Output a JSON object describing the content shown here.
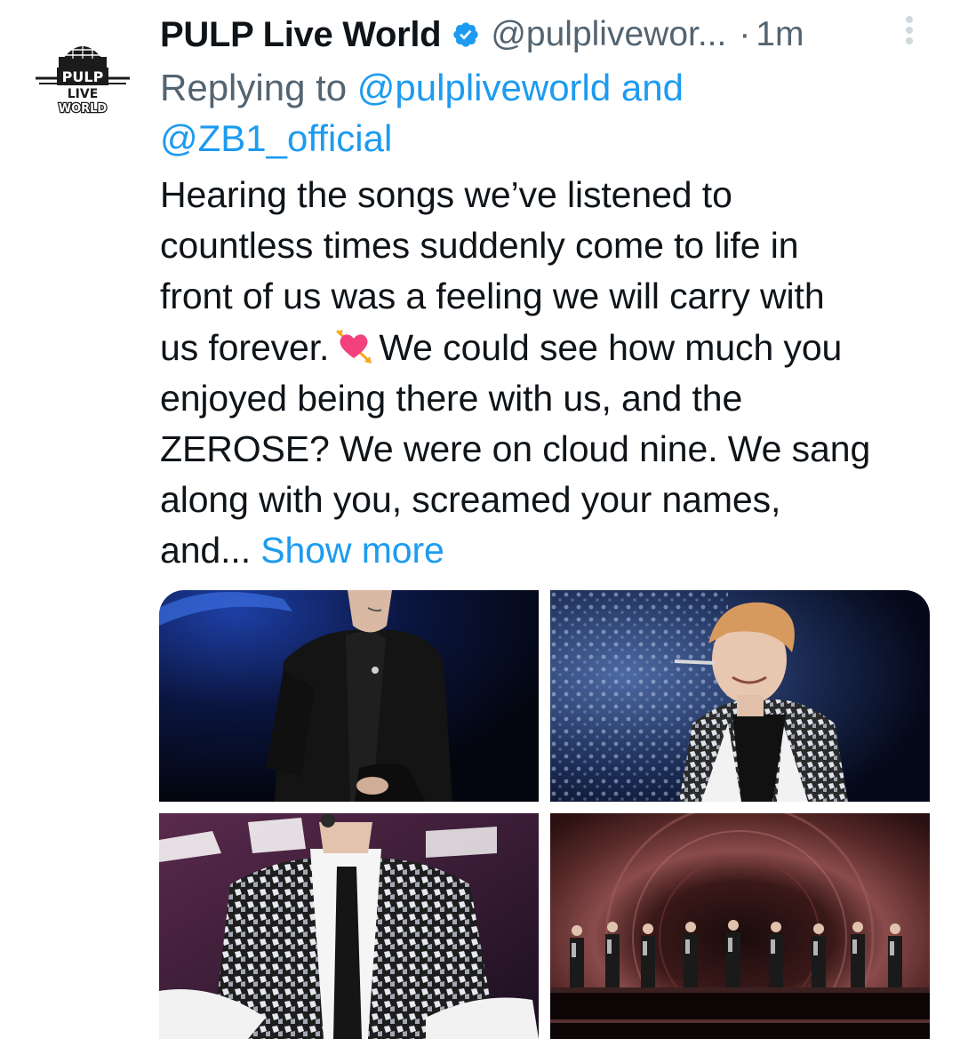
{
  "tweet": {
    "author": {
      "display_name": "PULP Live World",
      "handle": "@pulplivewor...",
      "verified": true,
      "avatar_text": [
        "PULP",
        "LIVE",
        "WORLD"
      ]
    },
    "separator": "·",
    "timestamp": "1m",
    "reply": {
      "prefix": "Replying to ",
      "mention_1": "@pulpliveworld",
      "joiner": " and",
      "mention_2": "@ZB1_official"
    },
    "body": {
      "line_1": "Hearing the songs we’ve listened to",
      "line_2": "countless times suddenly come to life in",
      "line_3": "front of us was a feeling we will carry with",
      "line_4_before_emoji": "us forever.",
      "emoji": "heart-with-arrow",
      "line_4_after_emoji": "We could see how much you",
      "line_5": "enjoyed being there with us, and the",
      "line_6": "ZEROSE? We were on cloud nine. We sang",
      "line_7": "along with you, screamed your names,",
      "line_8": "and...",
      "show_more": "Show more"
    },
    "media": {
      "count": 4,
      "photos": [
        "performer-black-shirt-photo",
        "performer-sequin-jacket-smiling-photo",
        "performer-sequin-jacket-tie-photo",
        "group-on-stage-photo"
      ]
    }
  },
  "colors": {
    "text": "#0f1419",
    "secondary": "#536471",
    "link": "#1d9bf0",
    "verified": "#1d9bf0"
  }
}
